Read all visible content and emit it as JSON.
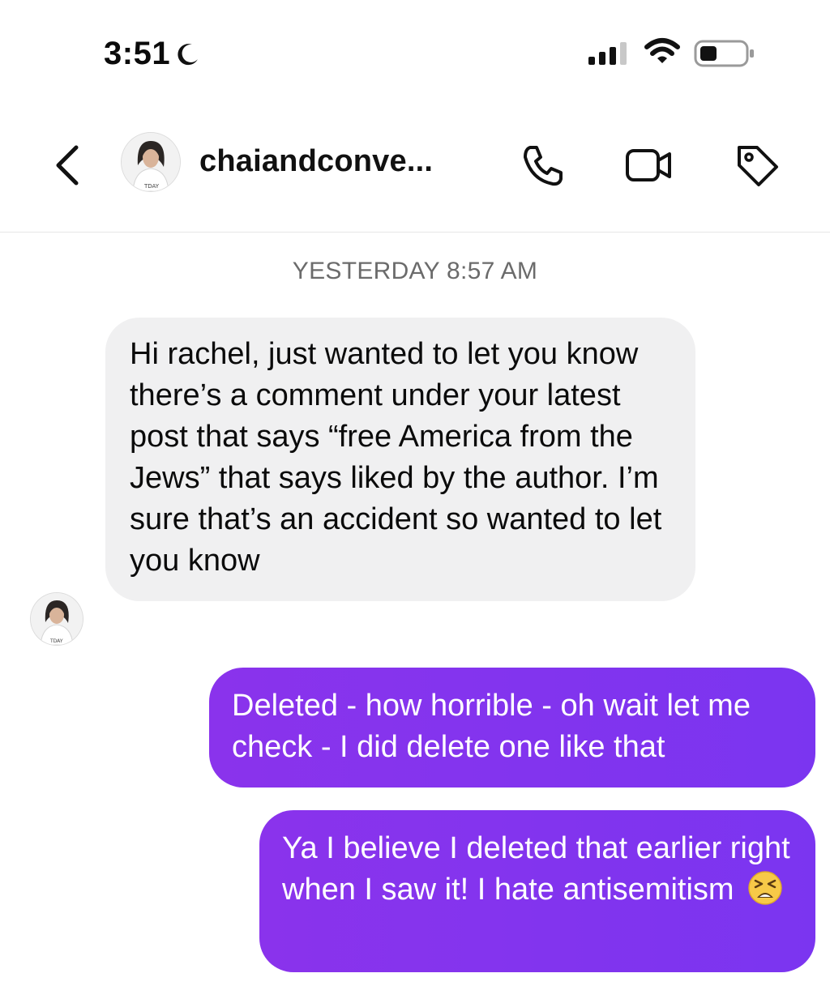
{
  "status_bar": {
    "time": "3:51",
    "icons": [
      "moon-icon",
      "signal-icon",
      "wifi-icon",
      "battery-icon"
    ]
  },
  "header": {
    "username": "chaiandconve...",
    "icons": [
      "back-chevron-icon",
      "phone-icon",
      "video-camera-icon",
      "tag-icon"
    ]
  },
  "thread": {
    "timestamp": "YESTERDAY 8:57 AM",
    "messages": [
      {
        "direction": "incoming",
        "text": "Hi rachel, just wanted to let you know there’s a comment under your latest post that says “free America from the Jews” that says liked by the author. I’m sure that’s an accident so wanted to let you know"
      },
      {
        "direction": "outgoing",
        "text": "Deleted - how horrible - oh wait let me check - I did delete one like that"
      },
      {
        "direction": "outgoing",
        "text": "Ya I believe I deleted that earlier right when I saw it! I hate antisemitism",
        "emoji": "tired-face-emoji"
      }
    ]
  },
  "colors": {
    "outgoing_bubble": "#8a33ec",
    "incoming_bubble": "#f0f0f1",
    "timestamp_text": "#6b6b6b"
  }
}
